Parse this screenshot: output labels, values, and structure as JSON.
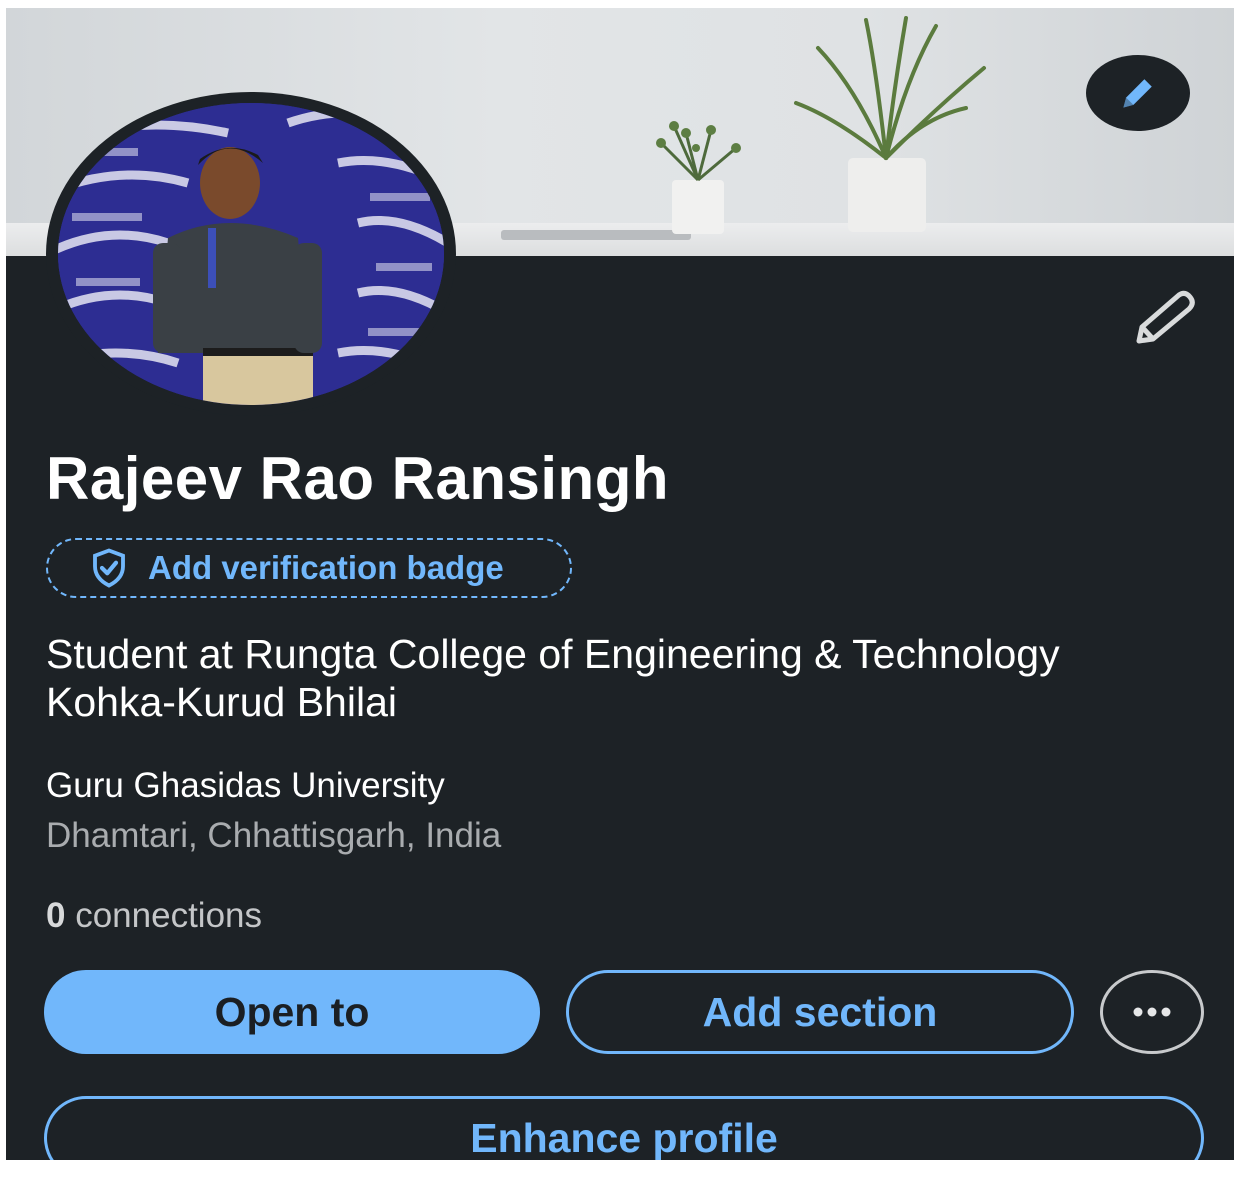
{
  "profile": {
    "name": "Rajeev Rao Ransingh",
    "verification_label": "Add verification badge",
    "headline": "Student at Rungta College of Engineering & Technology Kohka-Kurud Bhilai",
    "education": "Guru Ghasidas University",
    "location": "Dhamtari, Chhattisgarh, India",
    "connections_count": "0",
    "connections_label": "connections"
  },
  "actions": {
    "open_to": "Open to",
    "add_section": "Add section",
    "more": "···",
    "enhance_profile": "Enhance profile"
  },
  "icons": {
    "cover_edit": "pencil-icon",
    "intro_edit": "pencil-outline-icon",
    "verification": "shield-check-icon",
    "more": "ellipsis-icon"
  },
  "colors": {
    "background": "#1d2226",
    "accent": "#71b7fb",
    "text_primary": "#ffffff",
    "text_secondary": "#a9acaf"
  }
}
